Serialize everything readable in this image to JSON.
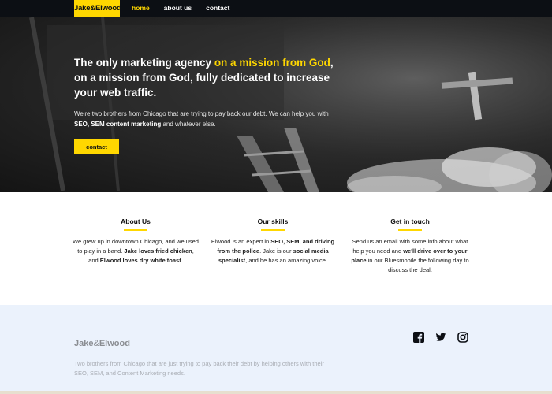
{
  "nav": {
    "logo": "Jake&Elwood",
    "links": [
      "home",
      "about us",
      "contact"
    ]
  },
  "hero": {
    "title_part1": "The only marketing agency ",
    "title_highlight": "on a mission from God",
    "title_part2": ", on a mission from God, fully dedicated to increase your web traffic.",
    "text_part1": "We're two brothers from Chicago that are trying to pay back our debt. We can help you with ",
    "text_bold": "SEO, SEM content marketing",
    "text_part2": " and whatever else.",
    "cta": "contact"
  },
  "features": [
    {
      "title": "About Us",
      "t1": "We grew up in downtown Chicago, and we used to play in a band. ",
      "b1": "Jake loves fried chicken",
      "t2": ", and ",
      "b2": "Elwood loves dry white toast",
      "t3": ".",
      "b3": "",
      "t4": ""
    },
    {
      "title": "Our skills",
      "t1": "Elwood is an expert in ",
      "b1": "SEO, SEM, and driving from the police",
      "t2": ". Jake is our ",
      "b2": "social media specialist",
      "t3": ", and he has an amazing voice.",
      "b3": "",
      "t4": ""
    },
    {
      "title": "Get in touch",
      "t1": "Send us an email with some info about what help you need and ",
      "b1": "we'll drive over to your place",
      "t2": " in our Bluesmobile the following day to discuss the deal.",
      "b2": "",
      "t3": "",
      "b3": "",
      "t4": ""
    }
  ],
  "footer": {
    "logo_a": "Jake",
    "logo_amp": "&",
    "logo_b": "Elwood",
    "text": "Two brothers from Chicago that are just trying to pay back their debt by helping others with their SEO, SEM, and Content Marketing needs.",
    "social_icons": [
      "facebook-icon",
      "twitter-icon",
      "instagram-icon"
    ]
  },
  "colors": {
    "accent": "#ffd700",
    "nav_bg": "#0c0f14",
    "footer_bg": "#ebf2fc"
  }
}
